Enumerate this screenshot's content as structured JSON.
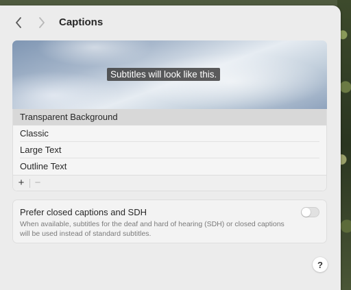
{
  "window": {
    "title": "Captions"
  },
  "preview": {
    "sample_text": "Subtitles will look like this."
  },
  "caption_styles": {
    "items": [
      {
        "label": "Transparent Background",
        "selected": true
      },
      {
        "label": "Classic",
        "selected": false
      },
      {
        "label": "Large Text",
        "selected": false
      },
      {
        "label": "Outline Text",
        "selected": false
      }
    ],
    "add_label": "+",
    "remove_label": "−"
  },
  "settings": {
    "sdh": {
      "title": "Prefer closed captions and SDH",
      "description": "When available, subtitles for the deaf and hard of hearing (SDH) or closed captions will be used instead of standard subtitles.",
      "enabled": false
    }
  },
  "help": {
    "label": "?"
  },
  "icons": {
    "back": "chevron-left-icon",
    "forward": "chevron-right-icon"
  },
  "colors": {
    "window_bg": "#ececec",
    "selected_row": "#d8d8d8",
    "toggle_off": "#e1e1e1"
  }
}
